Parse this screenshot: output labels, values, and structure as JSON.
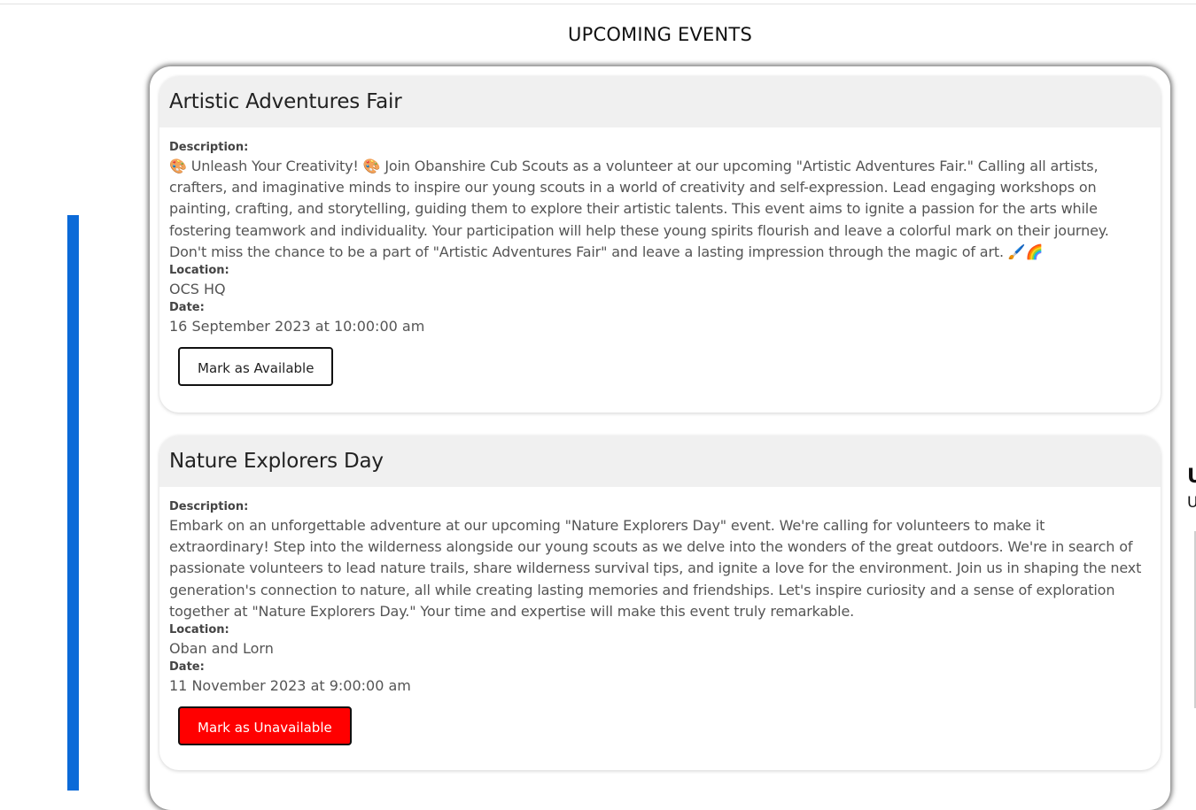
{
  "page": {
    "heading": "UPCOMING EVENTS"
  },
  "labels": {
    "description": "Description:",
    "location": "Location:",
    "date": "Date:"
  },
  "events": [
    {
      "title": "Artistic Adventures Fair",
      "description": "🎨 Unleash Your Creativity! 🎨 Join Obanshire Cub Scouts as a volunteer at our upcoming \"Artistic Adventures Fair.\" Calling all artists, crafters, and imaginative minds to inspire our young scouts in a world of creativity and self-expression. Lead engaging workshops on painting, crafting, and storytelling, guiding them to explore their artistic talents. This event aims to ignite a passion for the arts while fostering teamwork and individuality. Your participation will help these young spirits flourish and leave a colorful mark on their journey. Don't miss the chance to be a part of \"Artistic Adventures Fair\" and leave a lasting impression through the magic of art. 🖌️🌈",
      "location": "OCS HQ",
      "date": "16 September 2023 at 10:00:00 am",
      "action_label": "Mark as Available"
    },
    {
      "title": "Nature Explorers Day",
      "description": "Embark on an unforgettable adventure at our upcoming \"Nature Explorers Day\" event. We're calling for volunteers to make it extraordinary! Step into the wilderness alongside our young scouts as we delve into the wonders of the great outdoors. We're in search of passionate volunteers to lead nature trails, share wilderness survival tips, and ignite a love for the environment. Join us in shaping the next generation's connection to nature, all while creating lasting memories and friendships. Let's inspire curiosity and a sense of exploration together at \"Nature Explorers Day.\" Your time and expertise will make this event truly remarkable.",
      "location": "Oban and Lorn",
      "date": "11 November 2023 at 9:00:00 am",
      "action_label": "Mark as Unavailable"
    }
  ],
  "side_panel": {
    "peek_a": "U",
    "peek_b": "U"
  },
  "colors": {
    "accent_blue": "#0b6ad8",
    "unavailable_red": "#ff0000"
  }
}
